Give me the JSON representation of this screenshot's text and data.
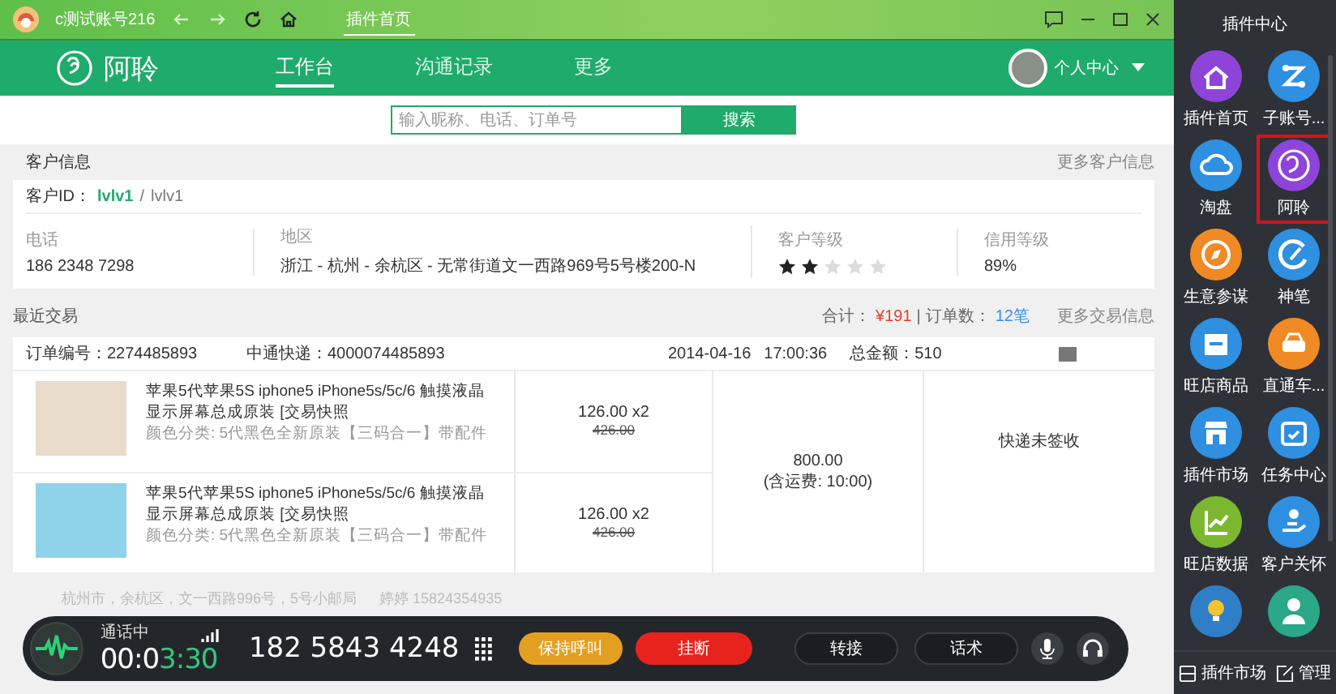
{
  "title_bar": {
    "account": "c测试账号216",
    "tab": "插件首页"
  },
  "app_nav": {
    "brand": "阿聆",
    "tabs": [
      {
        "label": "工作台",
        "selected": true
      },
      {
        "label": "沟通记录",
        "selected": false
      },
      {
        "label": "更多",
        "selected": false
      }
    ],
    "user": "个人中心"
  },
  "search": {
    "placeholder": "输入昵称、电话、订单号",
    "button": "搜索"
  },
  "customer": {
    "title": "客户信息",
    "more": "更多客户信息",
    "id_label": "客户ID：",
    "id": "lvlv1",
    "separator": "/",
    "nick": "lvlv1",
    "phone": {
      "label": "电话",
      "value": "186 2348 7298"
    },
    "region": {
      "label": "地区",
      "value": "浙江 - 杭州 - 余杭区 - 无常街道文一西路969号5号楼200-N"
    },
    "level": {
      "label": "客户等级",
      "stars": 2
    },
    "credit": {
      "label": "信用等级",
      "value": "89%"
    }
  },
  "trades": {
    "title": "最近交易",
    "total_label": "合计：",
    "total": "¥191",
    "divider": "|",
    "count_label": "订单数：",
    "count": "12笔",
    "more": "更多交易信息",
    "order": {
      "number": "订单编号：2274485893",
      "express": "中通快递：4000074485893",
      "date": "2014-04-16",
      "time": "17:00:36",
      "amount": "总金额：510",
      "items": [
        {
          "title": "苹果5代苹果5S iphone5 iPhone5s/5c/6 触摸液晶显示屏幕总成原装 [交易快照",
          "spec": "颜色分类: 5代黑色全新原装【三码合一】带配件",
          "price": "126.00 x2",
          "original": "426.00"
        },
        {
          "title": "苹果5代苹果5S iphone5 iPhone5s/5c/6 触摸液晶显示屏幕总成原装 [交易快照",
          "spec": "颜色分类: 5代黑色全新原装【三码合一】带配件",
          "price": "126.00 x2",
          "original": "426.00"
        }
      ],
      "total": "800.00",
      "shipping": "(含运费: 10:00)",
      "status": "快递未签收",
      "address": "杭州市，余杭区，文一西路996号，5号小邮局",
      "recipient": "婷婷 15824354935"
    }
  },
  "call_bar": {
    "status": "通话中",
    "timer_dim": "00:0",
    "timer_lit": "3:30",
    "number": "182 5843 4248",
    "buttons": [
      {
        "label": "保持呼叫",
        "kind": "hold"
      },
      {
        "label": "挂断",
        "kind": "hangup"
      },
      {
        "label": "转接",
        "kind": "plain"
      },
      {
        "label": "话术",
        "kind": "plain"
      }
    ]
  },
  "sidebar": {
    "title": "插件中心",
    "items": [
      {
        "label": "插件首页",
        "color": "#8e44d8",
        "selected": false
      },
      {
        "label": "子账号...",
        "color": "#2f8fe0",
        "selected": false
      },
      {
        "label": "淘盘",
        "color": "#2f8fe0",
        "selected": false
      },
      {
        "label": "阿聆",
        "color": "#8e44d8",
        "selected": true
      },
      {
        "label": "生意参谋",
        "color": "#f08a24",
        "selected": false
      },
      {
        "label": "神笔",
        "color": "#2f8fe0",
        "selected": false
      },
      {
        "label": "旺店商品",
        "color": "#2f8fe0",
        "selected": false
      },
      {
        "label": "直通车...",
        "color": "#f08a24",
        "selected": false
      },
      {
        "label": "插件市场",
        "color": "#2f8fe0",
        "selected": false
      },
      {
        "label": "任务中心",
        "color": "#2f8fe0",
        "selected": false
      },
      {
        "label": "旺店数据",
        "color": "#7cb82f",
        "selected": false
      },
      {
        "label": "客户关怀",
        "color": "#2f8fe0",
        "selected": false
      },
      {
        "color": "#2f7fc8",
        "selected": false
      },
      {
        "color": "#2aa888",
        "selected": false
      }
    ],
    "footer": [
      {
        "label": "插件市场"
      },
      {
        "label": "管理"
      }
    ]
  }
}
